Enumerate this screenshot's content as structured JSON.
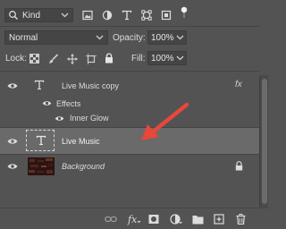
{
  "filter": {
    "kind_label": "Kind",
    "icons": [
      "image-filter-icon",
      "adjustment-filter-icon",
      "type-filter-icon",
      "shape-filter-icon",
      "smart-object-filter-icon",
      "filter-toggle-icon"
    ]
  },
  "blend": {
    "mode": "Normal",
    "opacity_label": "Opacity:",
    "opacity_value": "100%"
  },
  "lock": {
    "label": "Lock:",
    "fill_label": "Fill:",
    "fill_value": "100%"
  },
  "layers": [
    {
      "name": "Live Music copy",
      "type": "text",
      "fx": "fx",
      "effects_label": "Effects",
      "effect_item": "Inner Glow"
    },
    {
      "name": "Live Music",
      "type": "text",
      "selected": true
    },
    {
      "name": "Background",
      "type": "image",
      "locked": true
    }
  ],
  "colors": {
    "panel_bg": "#535353",
    "selected_row": "#6a6a6a",
    "arrow": "#e8473a"
  }
}
